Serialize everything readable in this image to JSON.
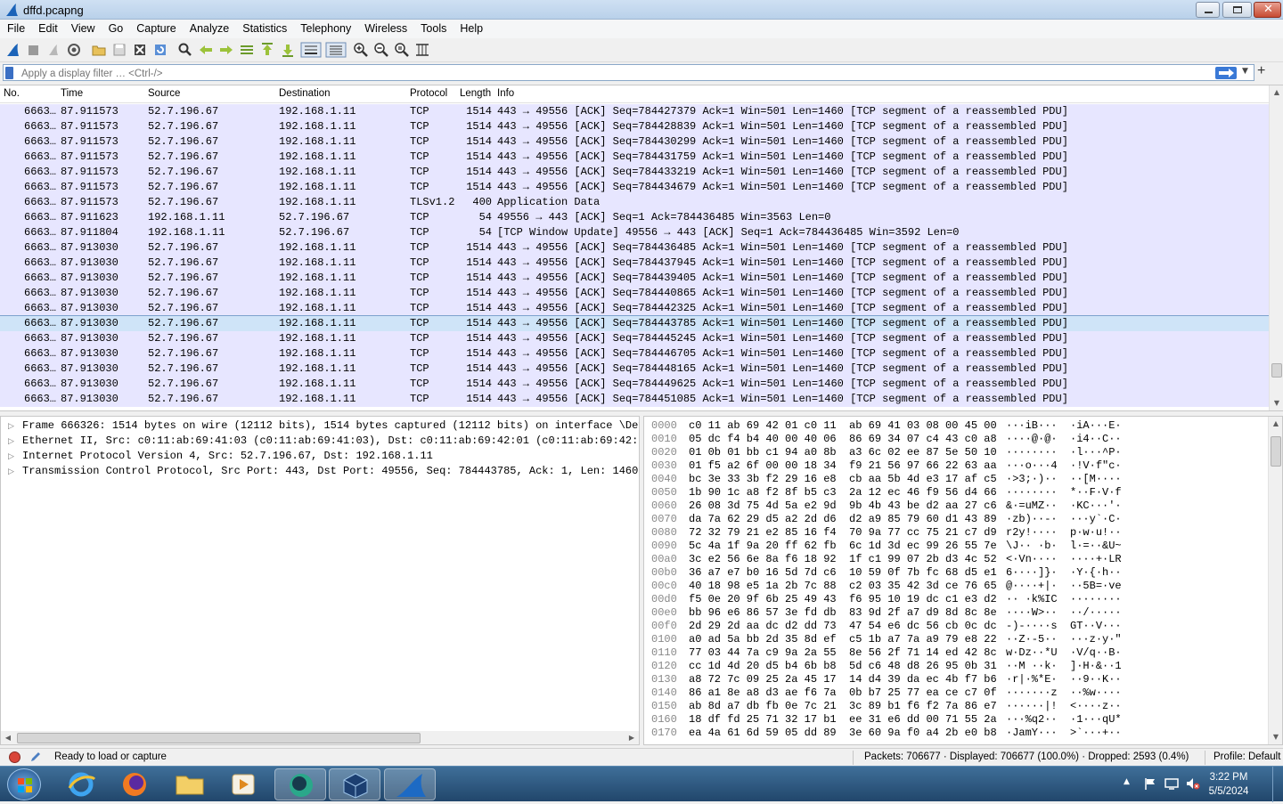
{
  "window": {
    "title": "dffd.pcapng"
  },
  "menu": [
    "File",
    "Edit",
    "View",
    "Go",
    "Capture",
    "Analyze",
    "Statistics",
    "Telephony",
    "Wireless",
    "Tools",
    "Help"
  ],
  "filter": {
    "placeholder": "Apply a display filter … <Ctrl-/>"
  },
  "columns": [
    "No.",
    "Time",
    "Source",
    "Destination",
    "Protocol",
    "Length",
    "Info"
  ],
  "packets": [
    {
      "no": "6663…",
      "time": "87.911573",
      "src": "52.7.196.67",
      "dst": "192.168.1.11",
      "proto": "TCP",
      "len": "1514",
      "info": "443 → 49556 [ACK] Seq=784427379 Ack=1 Win=501 Len=1460 [TCP segment of a reassembled PDU]"
    },
    {
      "no": "6663…",
      "time": "87.911573",
      "src": "52.7.196.67",
      "dst": "192.168.1.11",
      "proto": "TCP",
      "len": "1514",
      "info": "443 → 49556 [ACK] Seq=784428839 Ack=1 Win=501 Len=1460 [TCP segment of a reassembled PDU]"
    },
    {
      "no": "6663…",
      "time": "87.911573",
      "src": "52.7.196.67",
      "dst": "192.168.1.11",
      "proto": "TCP",
      "len": "1514",
      "info": "443 → 49556 [ACK] Seq=784430299 Ack=1 Win=501 Len=1460 [TCP segment of a reassembled PDU]"
    },
    {
      "no": "6663…",
      "time": "87.911573",
      "src": "52.7.196.67",
      "dst": "192.168.1.11",
      "proto": "TCP",
      "len": "1514",
      "info": "443 → 49556 [ACK] Seq=784431759 Ack=1 Win=501 Len=1460 [TCP segment of a reassembled PDU]"
    },
    {
      "no": "6663…",
      "time": "87.911573",
      "src": "52.7.196.67",
      "dst": "192.168.1.11",
      "proto": "TCP",
      "len": "1514",
      "info": "443 → 49556 [ACK] Seq=784433219 Ack=1 Win=501 Len=1460 [TCP segment of a reassembled PDU]"
    },
    {
      "no": "6663…",
      "time": "87.911573",
      "src": "52.7.196.67",
      "dst": "192.168.1.11",
      "proto": "TCP",
      "len": "1514",
      "info": "443 → 49556 [ACK] Seq=784434679 Ack=1 Win=501 Len=1460 [TCP segment of a reassembled PDU]"
    },
    {
      "no": "6663…",
      "time": "87.911573",
      "src": "52.7.196.67",
      "dst": "192.168.1.11",
      "proto": "TLSv1.2",
      "len": "400",
      "info": "Application Data"
    },
    {
      "no": "6663…",
      "time": "87.911623",
      "src": "192.168.1.11",
      "dst": "52.7.196.67",
      "proto": "TCP",
      "len": "54",
      "info": "49556 → 443 [ACK] Seq=1 Ack=784436485 Win=3563 Len=0"
    },
    {
      "no": "6663…",
      "time": "87.911804",
      "src": "192.168.1.11",
      "dst": "52.7.196.67",
      "proto": "TCP",
      "len": "54",
      "info": "[TCP Window Update] 49556 → 443 [ACK] Seq=1 Ack=784436485 Win=3592 Len=0"
    },
    {
      "no": "6663…",
      "time": "87.913030",
      "src": "52.7.196.67",
      "dst": "192.168.1.11",
      "proto": "TCP",
      "len": "1514",
      "info": "443 → 49556 [ACK] Seq=784436485 Ack=1 Win=501 Len=1460 [TCP segment of a reassembled PDU]"
    },
    {
      "no": "6663…",
      "time": "87.913030",
      "src": "52.7.196.67",
      "dst": "192.168.1.11",
      "proto": "TCP",
      "len": "1514",
      "info": "443 → 49556 [ACK] Seq=784437945 Ack=1 Win=501 Len=1460 [TCP segment of a reassembled PDU]"
    },
    {
      "no": "6663…",
      "time": "87.913030",
      "src": "52.7.196.67",
      "dst": "192.168.1.11",
      "proto": "TCP",
      "len": "1514",
      "info": "443 → 49556 [ACK] Seq=784439405 Ack=1 Win=501 Len=1460 [TCP segment of a reassembled PDU]"
    },
    {
      "no": "6663…",
      "time": "87.913030",
      "src": "52.7.196.67",
      "dst": "192.168.1.11",
      "proto": "TCP",
      "len": "1514",
      "info": "443 → 49556 [ACK] Seq=784440865 Ack=1 Win=501 Len=1460 [TCP segment of a reassembled PDU]"
    },
    {
      "no": "6663…",
      "time": "87.913030",
      "src": "52.7.196.67",
      "dst": "192.168.1.11",
      "proto": "TCP",
      "len": "1514",
      "info": "443 → 49556 [ACK] Seq=784442325 Ack=1 Win=501 Len=1460 [TCP segment of a reassembled PDU]"
    },
    {
      "no": "6663…",
      "time": "87.913030",
      "src": "52.7.196.67",
      "dst": "192.168.1.11",
      "proto": "TCP",
      "len": "1514",
      "info": "443 → 49556 [ACK] Seq=784443785 Ack=1 Win=501 Len=1460 [TCP segment of a reassembled PDU]",
      "selected": true
    },
    {
      "no": "6663…",
      "time": "87.913030",
      "src": "52.7.196.67",
      "dst": "192.168.1.11",
      "proto": "TCP",
      "len": "1514",
      "info": "443 → 49556 [ACK] Seq=784445245 Ack=1 Win=501 Len=1460 [TCP segment of a reassembled PDU]"
    },
    {
      "no": "6663…",
      "time": "87.913030",
      "src": "52.7.196.67",
      "dst": "192.168.1.11",
      "proto": "TCP",
      "len": "1514",
      "info": "443 → 49556 [ACK] Seq=784446705 Ack=1 Win=501 Len=1460 [TCP segment of a reassembled PDU]"
    },
    {
      "no": "6663…",
      "time": "87.913030",
      "src": "52.7.196.67",
      "dst": "192.168.1.11",
      "proto": "TCP",
      "len": "1514",
      "info": "443 → 49556 [ACK] Seq=784448165 Ack=1 Win=501 Len=1460 [TCP segment of a reassembled PDU]"
    },
    {
      "no": "6663…",
      "time": "87.913030",
      "src": "52.7.196.67",
      "dst": "192.168.1.11",
      "proto": "TCP",
      "len": "1514",
      "info": "443 → 49556 [ACK] Seq=784449625 Ack=1 Win=501 Len=1460 [TCP segment of a reassembled PDU]"
    },
    {
      "no": "6663…",
      "time": "87.913030",
      "src": "52.7.196.67",
      "dst": "192.168.1.11",
      "proto": "TCP",
      "len": "1514",
      "info": "443 → 49556 [ACK] Seq=784451085 Ack=1 Win=501 Len=1460 [TCP segment of a reassembled PDU]"
    }
  ],
  "details": [
    "Frame 666326: 1514 bytes on wire (12112 bits), 1514 bytes captured (12112 bits) on interface \\Devic",
    "Ethernet II, Src: c0:11:ab:69:41:03 (c0:11:ab:69:41:03), Dst: c0:11:ab:69:42:01 (c0:11:ab:69:42:01)",
    "Internet Protocol Version 4, Src: 52.7.196.67, Dst: 192.168.1.11",
    "Transmission Control Protocol, Src Port: 443, Dst Port: 49556, Seq: 784443785, Ack: 1, Len: 1460"
  ],
  "bytes": [
    {
      "off": "0000",
      "hex": "c0 11 ab 69 42 01 c0 11  ab 69 41 03 08 00 45 00",
      "ascii": "···iB···  ·iA···E·"
    },
    {
      "off": "0010",
      "hex": "05 dc f4 b4 40 00 40 06  86 69 34 07 c4 43 c0 a8",
      "ascii": "····@·@·  ·i4··C··"
    },
    {
      "off": "0020",
      "hex": "01 0b 01 bb c1 94 a0 8b  a3 6c 02 ee 87 5e 50 10",
      "ascii": "········  ·l···^P·"
    },
    {
      "off": "0030",
      "hex": "01 f5 a2 6f 00 00 18 34  f9 21 56 97 66 22 63 aa",
      "ascii": "···o···4  ·!V·f\"c·"
    },
    {
      "off": "0040",
      "hex": "bc 3e 33 3b f2 29 16 e8  cb aa 5b 4d e3 17 af c5",
      "ascii": "·>3;·)··  ··[M····"
    },
    {
      "off": "0050",
      "hex": "1b 90 1c a8 f2 8f b5 c3  2a 12 ec 46 f9 56 d4 66",
      "ascii": "········  *··F·V·f"
    },
    {
      "off": "0060",
      "hex": "26 08 3d 75 4d 5a e2 9d  9b 4b 43 be d2 aa 27 c6",
      "ascii": "&·=uMZ··  ·KC···'·"
    },
    {
      "off": "0070",
      "hex": "da 7a 62 29 d5 a2 2d d6  d2 a9 85 79 60 d1 43 89",
      "ascii": "·zb)··-·  ···y`·C·"
    },
    {
      "off": "0080",
      "hex": "72 32 79 21 e2 85 16 f4  70 9a 77 cc 75 21 c7 d9",
      "ascii": "r2y!····  p·w·u!··"
    },
    {
      "off": "0090",
      "hex": "5c 4a 1f 9a 20 ff 62 fb  6c 1d 3d ec 99 26 55 7e",
      "ascii": "\\J·· ·b·  l·=··&U~"
    },
    {
      "off": "00a0",
      "hex": "3c e2 56 6e 8a f6 18 92  1f c1 99 07 2b d3 4c 52",
      "ascii": "<·Vn····  ····+·LR"
    },
    {
      "off": "00b0",
      "hex": "36 a7 e7 b0 16 5d 7d c6  10 59 0f 7b fc 68 d5 e1",
      "ascii": "6····]}·  ·Y·{·h··"
    },
    {
      "off": "00c0",
      "hex": "40 18 98 e5 1a 2b 7c 88  c2 03 35 42 3d ce 76 65",
      "ascii": "@····+|·  ··5B=·ve"
    },
    {
      "off": "00d0",
      "hex": "f5 0e 20 9f 6b 25 49 43  f6 95 10 19 dc c1 e3 d2",
      "ascii": "·· ·k%IC  ········"
    },
    {
      "off": "00e0",
      "hex": "bb 96 e6 86 57 3e fd db  83 9d 2f a7 d9 8d 8c 8e",
      "ascii": "····W>··  ··/·····"
    },
    {
      "off": "00f0",
      "hex": "2d 29 2d aa dc d2 dd 73  47 54 e6 dc 56 cb 0c dc",
      "ascii": "-)-····s  GT··V···"
    },
    {
      "off": "0100",
      "hex": "a0 ad 5a bb 2d 35 8d ef  c5 1b a7 7a a9 79 e8 22",
      "ascii": "··Z·-5··  ···z·y·\""
    },
    {
      "off": "0110",
      "hex": "77 03 44 7a c9 9a 2a 55  8e 56 2f 71 14 ed 42 8c",
      "ascii": "w·Dz··*U  ·V/q··B·"
    },
    {
      "off": "0120",
      "hex": "cc 1d 4d 20 d5 b4 6b b8  5d c6 48 d8 26 95 0b 31",
      "ascii": "··M ··k·  ]·H·&··1"
    },
    {
      "off": "0130",
      "hex": "a8 72 7c 09 25 2a 45 17  14 d4 39 da ec 4b f7 b6",
      "ascii": "·r|·%*E·  ··9··K··"
    },
    {
      "off": "0140",
      "hex": "86 a1 8e a8 d3 ae f6 7a  0b b7 25 77 ea ce c7 0f",
      "ascii": "·······z  ··%w····"
    },
    {
      "off": "0150",
      "hex": "ab 8d a7 db fb 0e 7c 21  3c 89 b1 f6 f2 7a 86 e7",
      "ascii": "······|!  <····z··"
    },
    {
      "off": "0160",
      "hex": "18 df fd 25 71 32 17 b1  ee 31 e6 dd 00 71 55 2a",
      "ascii": "···%q2··  ·1···qU*"
    },
    {
      "off": "0170",
      "hex": "ea 4a 61 6d 59 05 dd 89  3e 60 9a f0 a4 2b e0 b8",
      "ascii": "·JamY···  >`···+··"
    }
  ],
  "status": {
    "ready": "Ready to load or capture",
    "packets": "Packets: 706677 · Displayed: 706677 (100.0%) · Dropped: 2593 (0.4%)",
    "profile": "Profile: Default"
  },
  "clock": {
    "time": "3:22 PM",
    "date": "5/5/2024"
  }
}
